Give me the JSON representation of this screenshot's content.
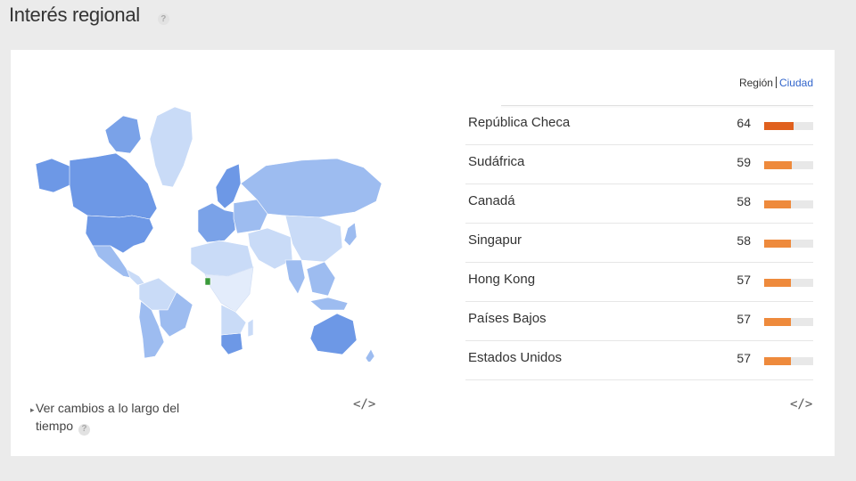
{
  "header": {
    "title": "Interés regional",
    "help": "?"
  },
  "toggle": {
    "region": "Región",
    "city": "Ciudad"
  },
  "ranking": [
    {
      "name": "República Checa",
      "value": 64,
      "color": "#e0601e"
    },
    {
      "name": "Sudáfrica",
      "value": 59,
      "color": "#ee8a3c"
    },
    {
      "name": "Canadá",
      "value": 58,
      "color": "#ee8a3c"
    },
    {
      "name": "Singapur",
      "value": 58,
      "color": "#ee8a3c"
    },
    {
      "name": "Hong Kong",
      "value": 57,
      "color": "#ee8a3c"
    },
    {
      "name": "Países Bajos",
      "value": 57,
      "color": "#ee8a3c"
    },
    {
      "name": "Estados Unidos",
      "value": 57,
      "color": "#ee8a3c"
    }
  ],
  "footer": {
    "text": "Ver cambios a lo largo del tiempo",
    "help": "?"
  },
  "embed": {
    "left": "</>",
    "right": "</>"
  },
  "colors": {
    "map_dark": "#6d98e6",
    "map_mid": "#9dbcf0",
    "map_light": "#c9dbf7",
    "map_green": "#3a9a3a"
  }
}
